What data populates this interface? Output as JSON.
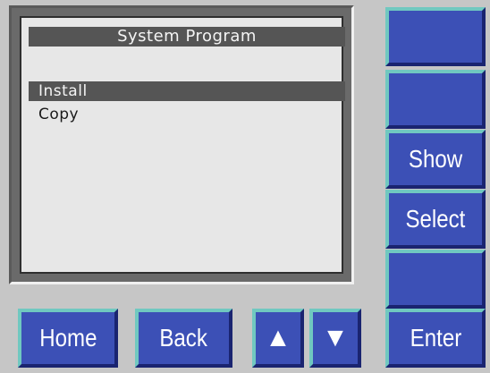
{
  "screen": {
    "title": "System Program",
    "menu_items": [
      {
        "label": "Install",
        "selected": true
      },
      {
        "label": "Copy",
        "selected": false
      }
    ]
  },
  "side_keys": [
    {
      "label": ""
    },
    {
      "label": ""
    },
    {
      "label": "Show"
    },
    {
      "label": "Select"
    },
    {
      "label": ""
    }
  ],
  "bottom_keys": {
    "home": "Home",
    "back": "Back",
    "up_icon": "▲",
    "down_icon": "▼",
    "enter": "Enter"
  },
  "colors": {
    "key_face": "#3c50b6",
    "key_highlight": "#70c8c0",
    "key_shadow": "#1a2470",
    "panel": "#c6c6c6",
    "screen_bg": "#e7e7e7",
    "selection_bar": "#555555"
  }
}
